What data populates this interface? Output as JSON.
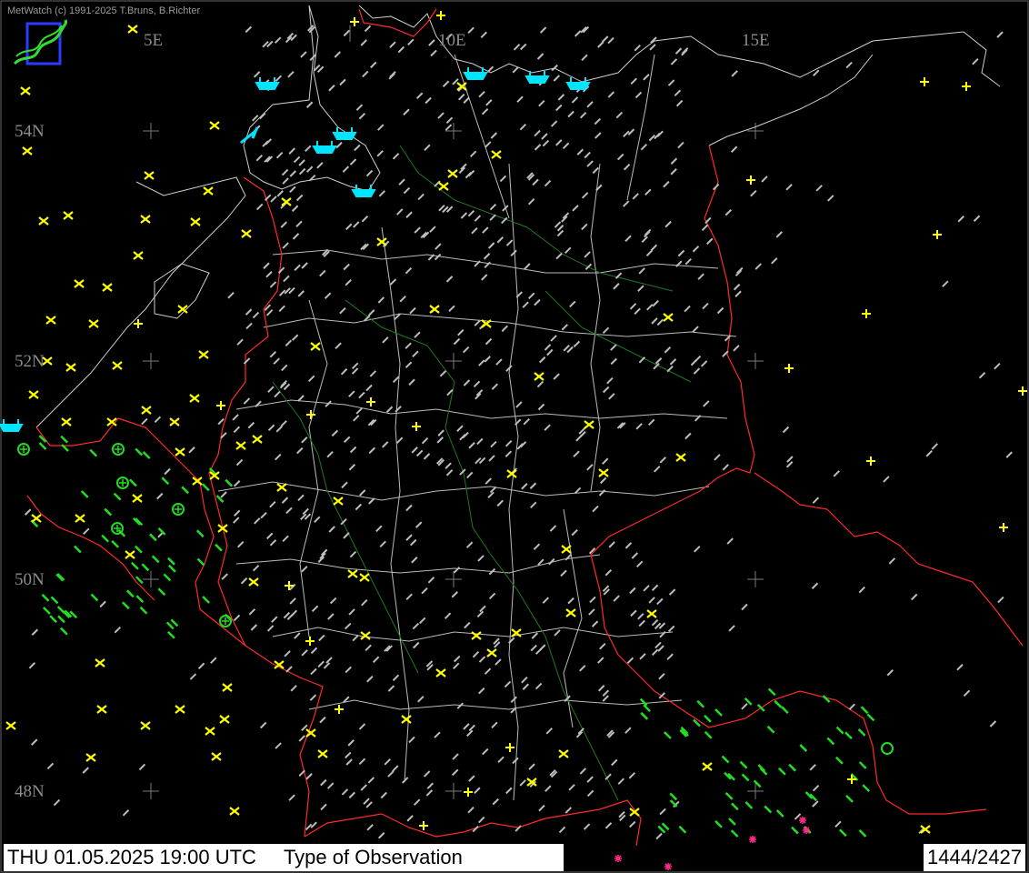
{
  "header": {
    "credit": "MetWatch  (c) 1991-2025 T.Bruns, B.Richter"
  },
  "grid_labels": {
    "lon": [
      "5E",
      "10E",
      "15E"
    ],
    "lat": [
      "54N",
      "52N",
      "50N",
      "48N"
    ]
  },
  "status": {
    "datetime": "THU 01.05.2025 19:00 UTC",
    "product": "Type of Observation",
    "count": "1444/2427"
  },
  "colors": {
    "background": "#000000",
    "border": "#ff2020",
    "region_lines": "#d8d8d8",
    "rivers": "#1f7a1f",
    "station_cross": "#ffff00",
    "station_plus": "#ffff00",
    "obs_dash": "#bdbdbd",
    "green_dash": "#22dd22",
    "ship": "#00e5ff",
    "magenta": "#ff2a88"
  },
  "legend_icons": [
    "x-station-icon",
    "plus-station-icon",
    "observation-dash-icon",
    "green-dash-icon",
    "ship-icon",
    "circle-plus-icon",
    "asterisk-icon",
    "ring-icon"
  ]
}
